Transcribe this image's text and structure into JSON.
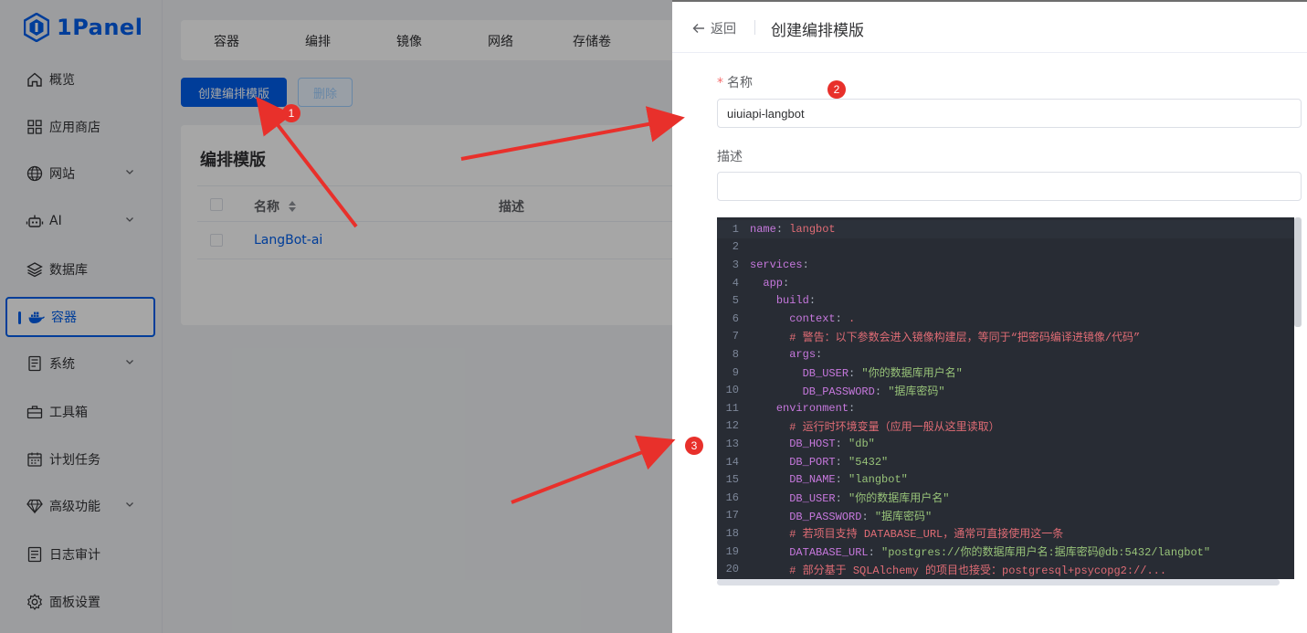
{
  "app": {
    "logo_text": "1Panel"
  },
  "sidebar": {
    "items": [
      {
        "label": "概览",
        "icon": "home-icon",
        "expandable": false
      },
      {
        "label": "应用商店",
        "icon": "grid-icon",
        "expandable": false
      },
      {
        "label": "网站",
        "icon": "globe-icon",
        "expandable": true
      },
      {
        "label": "AI",
        "icon": "robot-icon",
        "expandable": true
      },
      {
        "label": "数据库",
        "icon": "layers-icon",
        "expandable": false
      },
      {
        "label": "容器",
        "icon": "docker-icon",
        "expandable": false,
        "active": true
      },
      {
        "label": "系统",
        "icon": "server-icon",
        "expandable": true
      },
      {
        "label": "工具箱",
        "icon": "toolbox-icon",
        "expandable": false
      },
      {
        "label": "计划任务",
        "icon": "calendar-icon",
        "expandable": false
      },
      {
        "label": "高级功能",
        "icon": "diamond-icon",
        "expandable": true
      },
      {
        "label": "日志审计",
        "icon": "log-icon",
        "expandable": false
      },
      {
        "label": "面板设置",
        "icon": "settings-icon",
        "expandable": false
      }
    ]
  },
  "main": {
    "tabs": [
      "容器",
      "编排",
      "镜像",
      "网络",
      "存储卷"
    ],
    "create_button": "创建编排模版",
    "delete_button": "删除",
    "card_title": "编排模版",
    "table": {
      "columns": [
        "名称",
        "描述"
      ],
      "rows": [
        {
          "name": "LangBot-ai",
          "description": ""
        }
      ]
    }
  },
  "drawer": {
    "back_label": "返回",
    "title": "创建编排模版",
    "name_label": "名称",
    "name_value": "uiuiapi-langbot",
    "desc_label": "描述",
    "desc_value": "",
    "editor_lines": [
      "name: langbot",
      "",
      "services:",
      "  app:",
      "    build:",
      "      context: .",
      "      # 警告：以下参数会进入镜像构建层，等同于“把密码编译进镜像/代码”",
      "      args:",
      "        DB_USER: \"你的数据库用户名\"",
      "        DB_PASSWORD: \"据库密码\"",
      "    environment:",
      "      # 运行时环境变量（应用一般从这里读取）",
      "      DB_HOST: \"db\"",
      "      DB_PORT: \"5432\"",
      "      DB_NAME: \"langbot\"",
      "      DB_USER: \"你的数据库用户名\"",
      "      DB_PASSWORD: \"据库密码\"",
      "      # 若项目支持 DATABASE_URL，通常可直接使用这一条",
      "      DATABASE_URL: \"postgres://你的数据库用户名:据库密码@db:5432/langbot\"",
      "      # 部分基于 SQLAlchemy 的项目也接受：postgresql+psycopg2://..."
    ]
  },
  "annotations": {
    "badges": [
      "1",
      "2",
      "3"
    ],
    "color": "#e8302b"
  },
  "colors": {
    "brand": "#005eeb",
    "editor_bg": "#282c34"
  }
}
